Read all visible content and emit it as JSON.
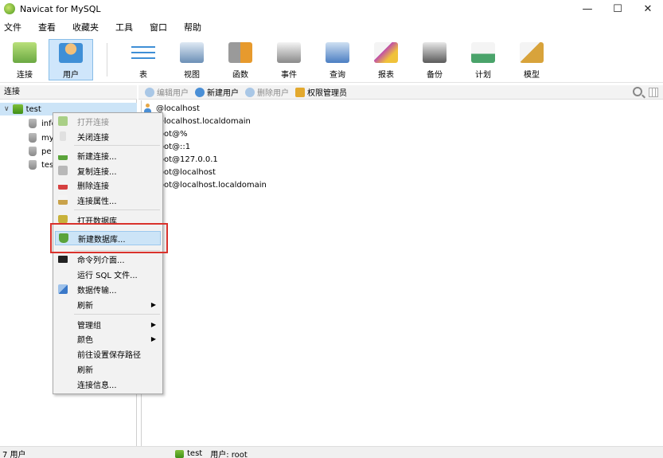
{
  "window": {
    "title": "Navicat for MySQL",
    "minimize": "—",
    "maximize": "☐",
    "close": "✕"
  },
  "menu": [
    "文件",
    "查看",
    "收藏夹",
    "工具",
    "窗口",
    "帮助"
  ],
  "toolbar": {
    "items": [
      {
        "label": "连接",
        "icon": "connection-icon",
        "color": "#6aa842"
      },
      {
        "label": "用户",
        "icon": "user-icon",
        "color": "#3f8fd6",
        "active": true
      },
      {
        "label": "表",
        "icon": "table-icon",
        "color": "#3f8fd6"
      },
      {
        "label": "视图",
        "icon": "view-icon",
        "color": "#6b8fb6"
      },
      {
        "label": "函数",
        "icon": "function-icon",
        "color": "#e79a2d"
      },
      {
        "label": "事件",
        "icon": "event-icon",
        "color": "#8a8a8a"
      },
      {
        "label": "查询",
        "icon": "query-icon",
        "color": "#4b7ec2"
      },
      {
        "label": "报表",
        "icon": "report-icon",
        "color": "#c04fa8"
      },
      {
        "label": "备份",
        "icon": "backup-icon",
        "color": "#5a5a5a"
      },
      {
        "label": "计划",
        "icon": "schedule-icon",
        "color": "#4aa36a"
      },
      {
        "label": "模型",
        "icon": "model-icon",
        "color": "#d8a33b"
      }
    ]
  },
  "left": {
    "header": "连接",
    "root": {
      "label": "test",
      "chevron": "∨"
    },
    "databases": [
      "info",
      "my",
      "pe",
      "tes"
    ]
  },
  "right": {
    "actions": [
      {
        "label": "编辑用户",
        "disabled": true,
        "icon": "edit-user-icon"
      },
      {
        "label": "新建用户",
        "disabled": false,
        "icon": "new-user-icon"
      },
      {
        "label": "删除用户",
        "disabled": true,
        "icon": "delete-user-icon"
      },
      {
        "label": "权限管理员",
        "disabled": false,
        "icon": "lock-icon"
      }
    ],
    "users": [
      "@localhost",
      "@localhost.localdomain",
      "root@%",
      "root@::1",
      "root@127.0.0.1",
      "root@localhost",
      "root@localhost.localdomain"
    ]
  },
  "context_menu": {
    "items": [
      {
        "label": "打开连接",
        "disabled": true,
        "icon": "open-connection-icon",
        "color": "#8fbf6a"
      },
      {
        "label": "关闭连接",
        "disabled": false,
        "icon": "close-connection-icon",
        "color": "#d0d0d0"
      },
      {
        "sep": true
      },
      {
        "label": "新建连接...",
        "icon": "new-connection-icon",
        "color": "#5aa33a"
      },
      {
        "label": "复制连接...",
        "icon": "copy-connection-icon",
        "color": "#9a9a9a"
      },
      {
        "label": "删除连接",
        "icon": "delete-connection-icon",
        "color": "#d64040"
      },
      {
        "label": "连接属性...",
        "icon": "connection-properties-icon",
        "color": "#c9a24a"
      },
      {
        "sep": true
      },
      {
        "label": "打开数据库",
        "icon": "open-database-icon",
        "color": "#c8b23a"
      },
      {
        "label": "新建数据库...",
        "icon": "new-database-icon",
        "color": "#5aa33a",
        "highlight": true
      },
      {
        "sep": true
      },
      {
        "label": "命令列介面...",
        "icon": "console-icon",
        "color": "#222222"
      },
      {
        "label": "运行 SQL 文件...",
        "icon": "none"
      },
      {
        "label": "数据传输...",
        "icon": "data-transfer-icon",
        "color": "#3a78c8"
      },
      {
        "label": "刷新",
        "icon": "none",
        "submenu": true
      },
      {
        "sep": true
      },
      {
        "label": "管理组",
        "icon": "none",
        "submenu": true
      },
      {
        "label": "颜色",
        "icon": "none",
        "submenu": true
      },
      {
        "label": "前往设置保存路径",
        "icon": "none"
      },
      {
        "label": "刷新",
        "icon": "none"
      },
      {
        "label": "连接信息...",
        "icon": "none"
      }
    ]
  },
  "status": {
    "count": "7 用户",
    "connection": "test",
    "user": "用户: root"
  }
}
